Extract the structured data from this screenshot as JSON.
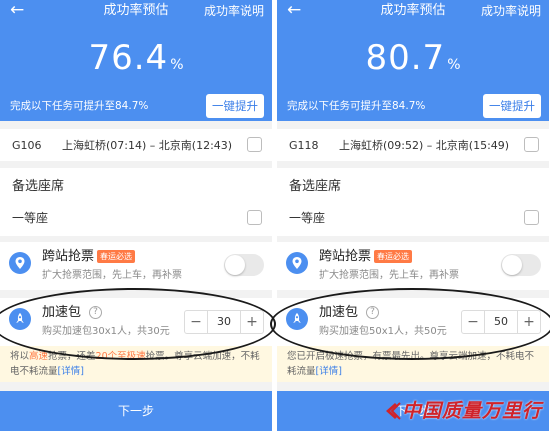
{
  "left": {
    "header": {
      "back": "←",
      "title": "成功率预估",
      "explain": "成功率说明"
    },
    "rate": {
      "value": "76.4",
      "unit": "%"
    },
    "tip": "完成以下任务可提升至84.7%",
    "boost_button": "一键提升",
    "train": {
      "code": "G106",
      "route": "上海虹桥(07:14) – 北京南(12:43)"
    },
    "seats": {
      "label": "备选座席",
      "seat": "一等座"
    },
    "cross": {
      "name": "跨站抢票",
      "question": "?",
      "tag": "春运必选",
      "desc": "扩大抢票范围，先上车，再补票"
    },
    "accel": {
      "name": "加速包",
      "question": "?",
      "desc": "购买加速包30x1人，共30元",
      "minus": "−",
      "value": "30",
      "plus": "+"
    },
    "hint": {
      "pre": "将以",
      "hl1": "高速",
      "mid": "抢票，还差",
      "hl2": "20个至极速",
      "post": "抢票。尊享云端加速，不耗电不耗流量",
      "link": "[详情]"
    },
    "next": "下一步"
  },
  "right": {
    "header": {
      "back": "←",
      "title": "成功率预估",
      "explain": "成功率说明"
    },
    "rate": {
      "value": "80.7",
      "unit": "%"
    },
    "tip": "完成以下任务可提升至84.7%",
    "boost_button": "一键提升",
    "train": {
      "code": "G118",
      "route": "上海虹桥(09:52) – 北京南(15:49)"
    },
    "seats": {
      "label": "备选座席",
      "seat": "一等座"
    },
    "cross": {
      "name": "跨站抢票",
      "question": "?",
      "tag": "春运必选",
      "desc": "扩大抢票范围，先上车，再补票"
    },
    "accel": {
      "name": "加速包",
      "question": "?",
      "desc": "购买加速包50x1人，共50元",
      "minus": "−",
      "value": "50",
      "plus": "+"
    },
    "hint": {
      "text": "您已开启极速抢票，有票最先出。尊享云端加速，不耗电不耗流量",
      "link": "[详情]"
    },
    "next": "下一步"
  },
  "watermark": {
    "text": "中国质量万里行"
  },
  "colors": {
    "primary": "#4c8ff0",
    "accent": "#ff7a45",
    "annotation": "#1a1a1a",
    "watermark": "#d0232a"
  }
}
